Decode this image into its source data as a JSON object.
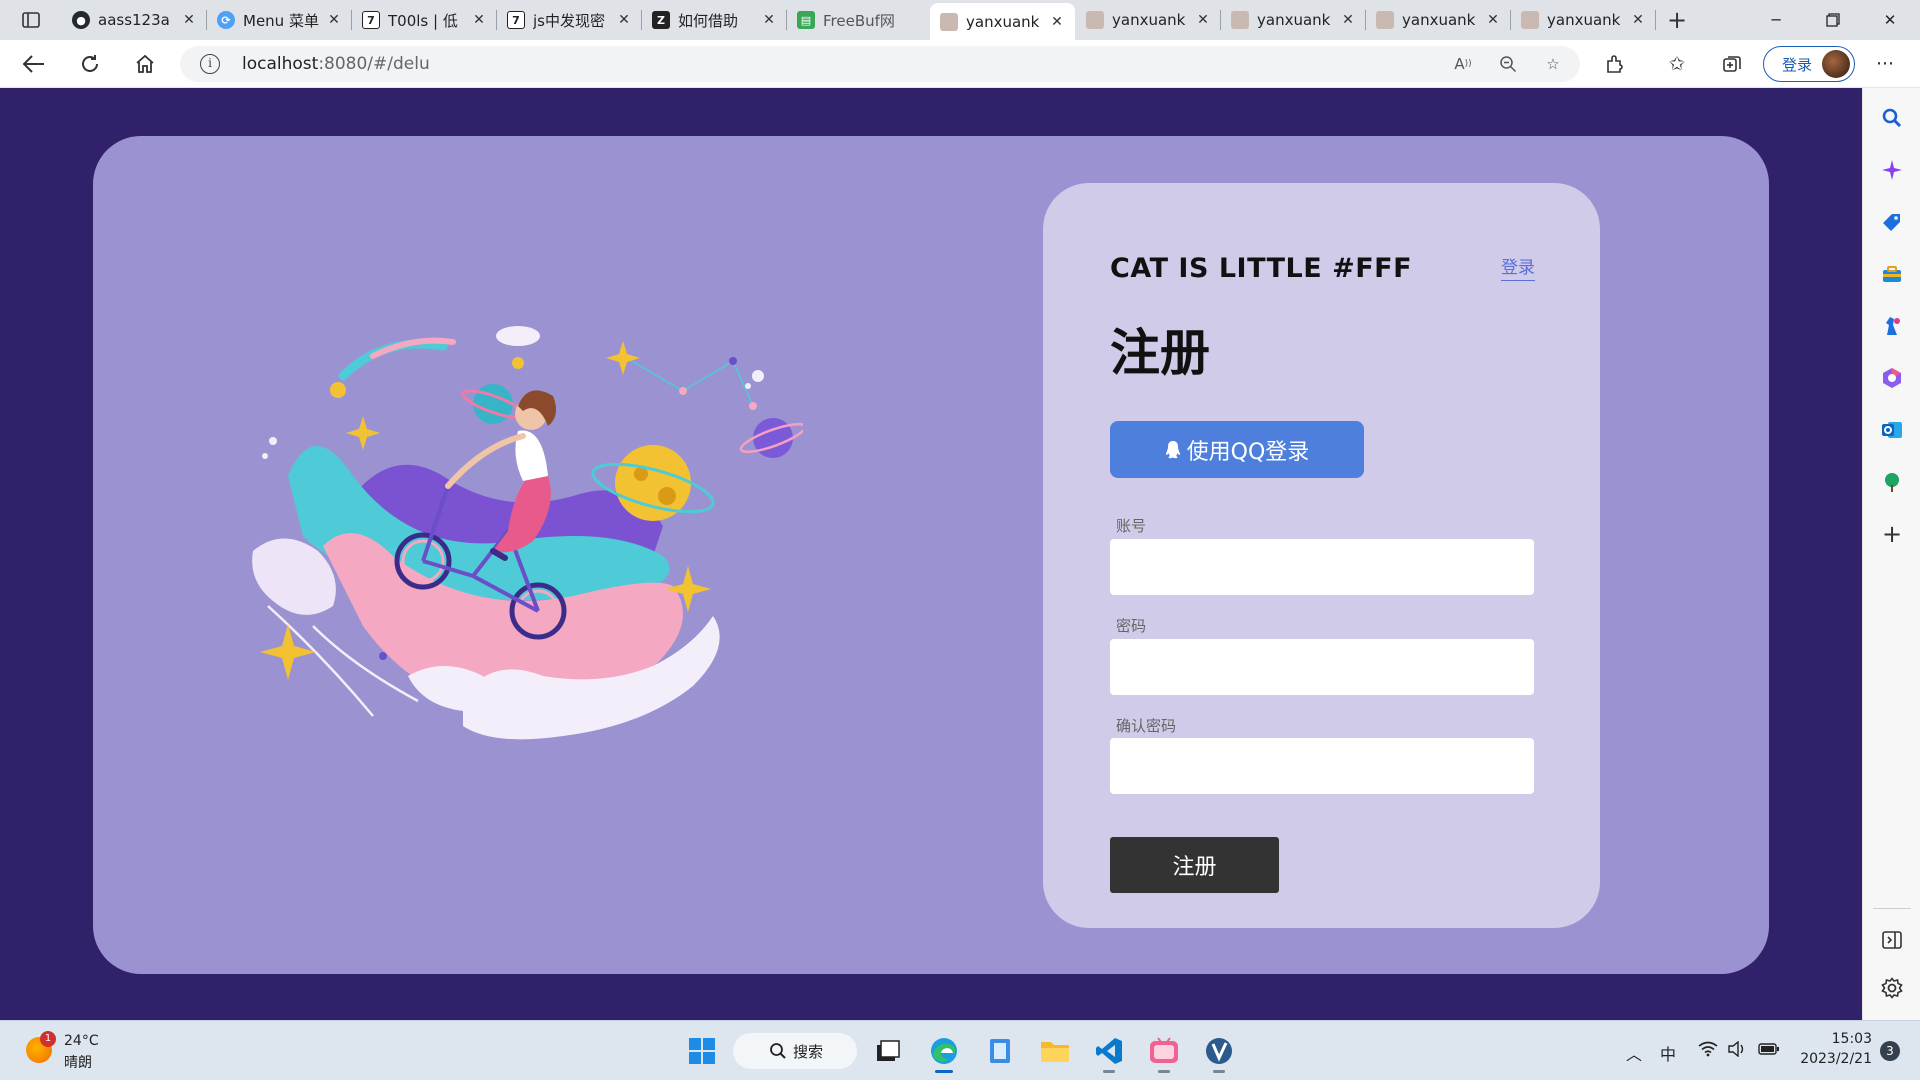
{
  "browser": {
    "tabs": [
      {
        "title": "aass123a",
        "favicon": "github-icon",
        "active": false
      },
      {
        "title": "Menu 菜单",
        "favicon": "element-ui-icon",
        "active": false
      },
      {
        "title": "T00ls | 低",
        "favicon": "t00ls-icon",
        "active": false
      },
      {
        "title": "js中发现密",
        "favicon": "t00ls-icon",
        "active": false
      },
      {
        "title": "如何借助",
        "favicon": "zhihu-style-icon",
        "active": false
      },
      {
        "title": "FreeBuf网",
        "favicon": "freebuf-icon",
        "active": false
      },
      {
        "title": "yanxuank",
        "favicon": "avatar-favicon",
        "active": true
      },
      {
        "title": "yanxuank",
        "favicon": "avatar-favicon",
        "active": false
      },
      {
        "title": "yanxuank",
        "favicon": "avatar-favicon",
        "active": false
      },
      {
        "title": "yanxuank",
        "favicon": "avatar-favicon",
        "active": false
      },
      {
        "title": "yanxuank",
        "favicon": "avatar-favicon",
        "active": false
      }
    ],
    "address": {
      "host": "localhost",
      "path": ":8080/#/delu"
    },
    "profile_button": "登录"
  },
  "page": {
    "brand": "CAT IS LITTLE #FFF",
    "login_link": "登录",
    "heading": "注册",
    "qq_button": "使用QQ登录",
    "fields": [
      {
        "label": "账号",
        "value": ""
      },
      {
        "label": "密码",
        "value": ""
      },
      {
        "label": "确认密码",
        "value": ""
      }
    ],
    "submit": "注册",
    "colors": {
      "page_bg": "#31206a",
      "card_bg": "#9b93d1",
      "form_bg": "#d0cbe9",
      "qq_button": "#4f7fdd",
      "submit_button": "#333333",
      "link": "#5b6fd6"
    }
  },
  "sidebar": {
    "icons": [
      "search-icon",
      "copilot-icon",
      "shopping-tag-icon",
      "toolbox-icon",
      "games-icon",
      "office-icon",
      "outlook-icon",
      "tree-icon",
      "add-icon",
      "split-screen-icon",
      "settings-icon"
    ]
  },
  "taskbar": {
    "weather": {
      "temp": "24°C",
      "condition": "晴朗",
      "badge": "1"
    },
    "search_label": "搜索",
    "apps": [
      "windows-start-icon",
      "search-icon",
      "task-view-icon",
      "edge-icon",
      "notepad-icon",
      "file-explorer-icon",
      "vscode-icon",
      "bilibili-icon",
      "vmware-icon"
    ],
    "tray": {
      "ime": "中",
      "time": "15:03",
      "date": "2023/2/21",
      "notifications": "3"
    }
  }
}
